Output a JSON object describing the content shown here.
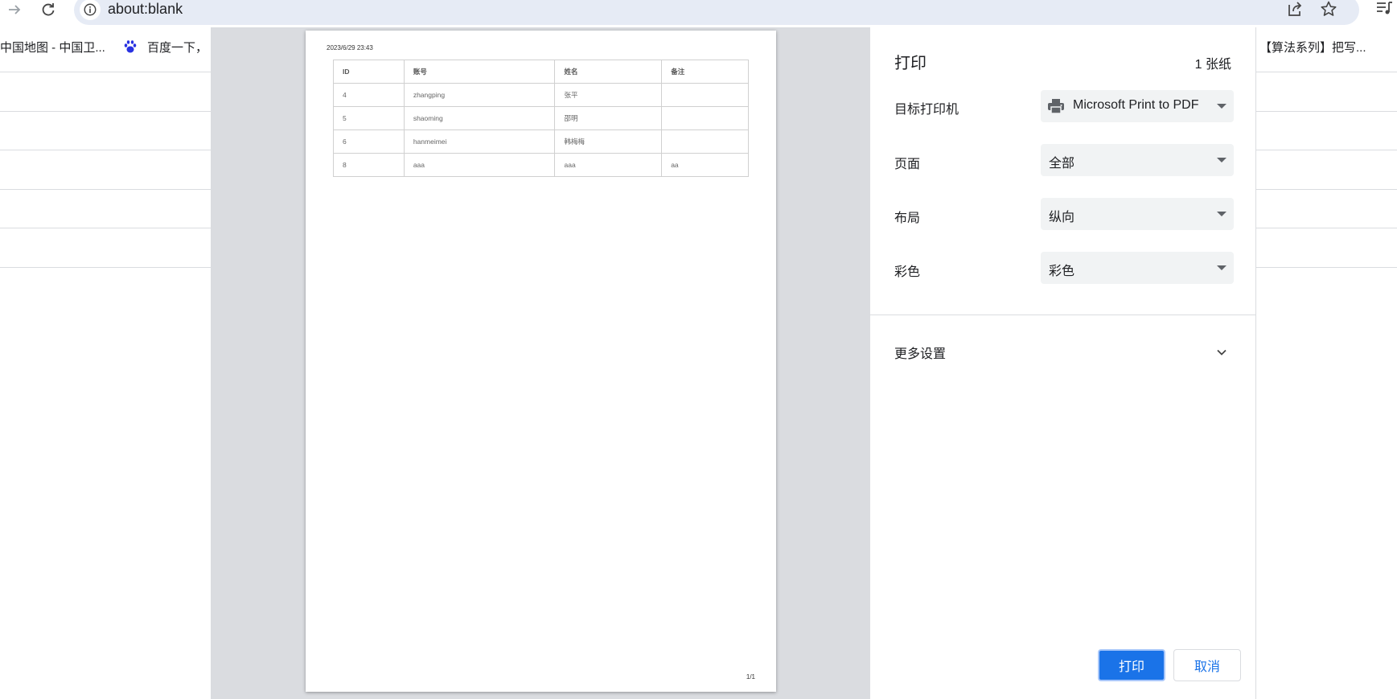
{
  "browser": {
    "url": "about:blank",
    "icons": {
      "forward": "arrow-forward-icon",
      "reload": "reload-icon",
      "info": "info-icon",
      "share": "share-icon",
      "star": "star-icon",
      "media": "media-control-icon"
    },
    "bookmarks": [
      {
        "label": "中国地图 - 中国卫..."
      },
      {
        "label": "百度一下，",
        "icon": "baidu-paw-icon"
      },
      {
        "label": "【算法系列】把写..."
      }
    ]
  },
  "preview": {
    "date": "2023/6/29 23:43",
    "page_number": "1/1",
    "table": {
      "headers": [
        "ID",
        "账号",
        "姓名",
        "备注"
      ],
      "rows": [
        [
          "4",
          "zhangping",
          "张平",
          ""
        ],
        [
          "5",
          "shaoming",
          "邵明",
          ""
        ],
        [
          "6",
          "hanmeimei",
          "韩梅梅",
          ""
        ],
        [
          "8",
          "aaa",
          "aaa",
          "aa"
        ]
      ]
    }
  },
  "settings": {
    "title": "打印",
    "sheet_count": "1 张纸",
    "destination": {
      "label": "目标打印机",
      "value": "Microsoft Print to PDF",
      "icon": "printer-icon"
    },
    "pages": {
      "label": "页面",
      "value": "全部"
    },
    "layout": {
      "label": "布局",
      "value": "纵向"
    },
    "color": {
      "label": "彩色",
      "value": "彩色"
    },
    "more_settings": "更多设置",
    "print_button": "打印",
    "cancel_button": "取消"
  },
  "colors": {
    "accent": "#1a73e8",
    "preview_background": "#dadce0",
    "dropdown_background": "#f1f3f4"
  }
}
